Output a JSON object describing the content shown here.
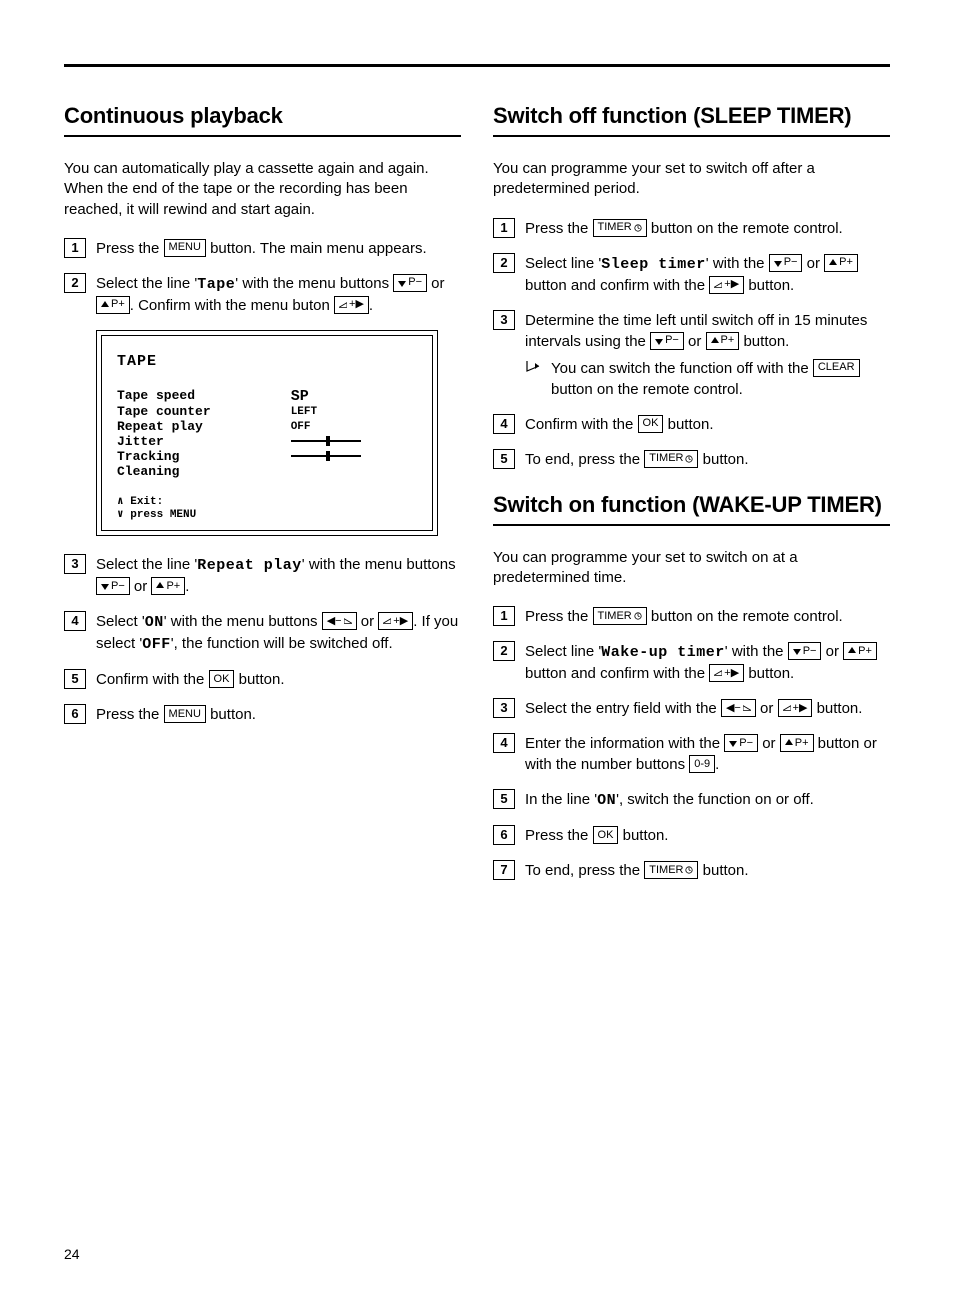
{
  "page_number": "24",
  "left": {
    "heading": "Continuous playback",
    "intro": "You can automatically play a cassette again and again. When the end of the tape or the recording has been reached, it will rewind and start again.",
    "steps": {
      "s1a": "Press the ",
      "s1b": " button. The main menu appears.",
      "s2a": "Select the line '",
      "s2b": "Tape",
      "s2c": "' with the menu buttons ",
      "s2d": " or ",
      "s2e": ". Confirm with the menu buton ",
      "s2f": ".",
      "s3a": "Select the line '",
      "s3b": "Repeat play",
      "s3c": "' with the menu buttons ",
      "s3d": " or ",
      "s3e": ".",
      "s4a": "Select '",
      "s4b": "ON",
      "s4c": "' with the menu buttons ",
      "s4d": " or ",
      "s4e": ". If you select '",
      "s4f": "OFF",
      "s4g": "', the function will be switched off.",
      "s5a": "Confirm with the ",
      "s5b": " button.",
      "s6a": "Press the ",
      "s6b": " button."
    },
    "screen": {
      "title": "TAPE",
      "rows": [
        {
          "label": "Tape speed",
          "value": "SP",
          "bold": true
        },
        {
          "label": "Tape counter",
          "value": "LEFT"
        },
        {
          "label": "Repeat play",
          "value": "OFF"
        },
        {
          "label": "Jitter",
          "value": "slider"
        },
        {
          "label": "Tracking",
          "value": "slider"
        },
        {
          "label": "Cleaning",
          "value": ""
        }
      ],
      "footer_top": "∧ Exit:",
      "footer_bottom": "∨ press MENU"
    }
  },
  "right_a": {
    "heading": "Switch off function (SLEEP TIMER)",
    "intro": "You can programme your set to switch off after a predetermined period.",
    "steps": {
      "s1a": "Press the ",
      "s1b": " button on the remote control.",
      "s2a": "Select line '",
      "s2b": "Sleep timer",
      "s2c": "' with the ",
      "s2d": " or ",
      "s2e": " button and confirm with the ",
      "s2f": " button.",
      "s3a": "Determine the time left until switch off in 15 minutes intervals using the ",
      "s3b": " or ",
      "s3c": " button.",
      "note_a": "You can switch the function off with the ",
      "note_b": " button on the remote control.",
      "s4a": "Confirm with the ",
      "s4b": " button.",
      "s5a": "To end, press the ",
      "s5b": " button."
    }
  },
  "right_b": {
    "heading": "Switch on function (WAKE-UP TIMER)",
    "intro": "You can programme your set to switch on at a predetermined time.",
    "steps": {
      "s1a": "Press the ",
      "s1b": " button on the remote control.",
      "s2a": "Select line '",
      "s2b": "Wake-up timer",
      "s2c": "' with the ",
      "s2d": " or ",
      "s2e": " button and confirm with the ",
      "s2f": " button.",
      "s3a": "Select the entry field with the ",
      "s3b": " or ",
      "s3c": " button.",
      "s4a": "Enter the information with the ",
      "s4b": " or ",
      "s4c": " button or with the number buttons ",
      "s4d": ".",
      "s5a": "In the line '",
      "s5b": "ON",
      "s5c": "', switch the function on or off.",
      "s6a": "Press the ",
      "s6b": " button.",
      "s7a": "To end, press the ",
      "s7b": " button."
    }
  },
  "buttons": {
    "menu": "MENU",
    "ok": "OK",
    "clear": "CLEAR",
    "timer": "TIMER",
    "num": "0-9",
    "p_minus": "P−",
    "p_plus": "P+",
    "plus_right": "+▶",
    "minus_left": "◀−"
  }
}
